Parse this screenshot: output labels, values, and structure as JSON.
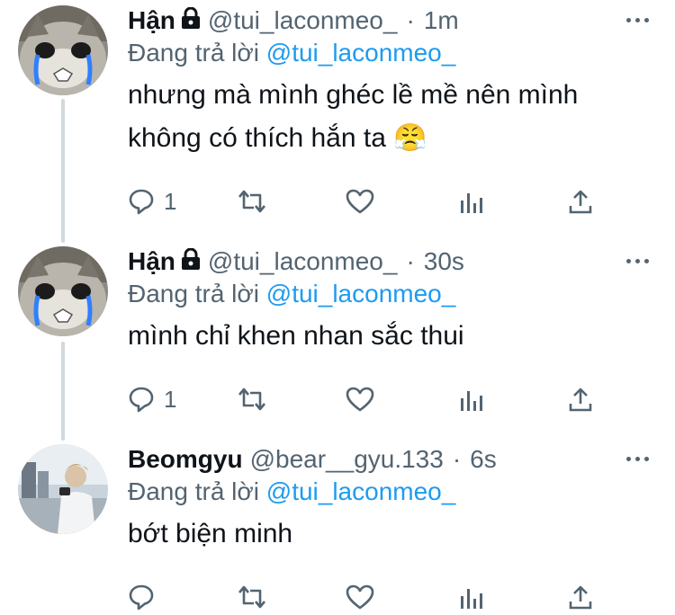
{
  "tweets": [
    {
      "name": "Hận",
      "locked": true,
      "handle": "@tui_laconmeo_",
      "separator": "·",
      "time": "1m",
      "replying_prefix": "Đang trả lời",
      "replying_to": "@tui_laconmeo_",
      "text": "nhưng mà mình ghéc lề mề nên mình không có thích hắn ta 😤",
      "reply_count": "1",
      "avatar": "cat-avatar"
    },
    {
      "name": "Hận",
      "locked": true,
      "handle": "@tui_laconmeo_",
      "separator": "·",
      "time": "30s",
      "replying_prefix": "Đang trả lời",
      "replying_to": "@tui_laconmeo_",
      "text": "mình chỉ khen nhan sắc thui",
      "reply_count": "1",
      "avatar": "cat-avatar"
    },
    {
      "name": "Beomgyu",
      "locked": false,
      "handle": "@bear__gyu.133",
      "separator": "·",
      "time": "6s",
      "replying_prefix": "Đang trả lời",
      "replying_to": "@tui_laconmeo_",
      "text": "bớt biện minh",
      "reply_count": "",
      "avatar": "person-avatar"
    }
  ],
  "colors": {
    "text": "#0f1419",
    "secondary": "#536471",
    "mention": "#1d9bf0",
    "thread_line": "#cfd9de"
  },
  "icons": [
    "lock-icon",
    "more-icon",
    "reply-icon",
    "retweet-icon",
    "like-icon",
    "views-icon",
    "share-icon"
  ]
}
